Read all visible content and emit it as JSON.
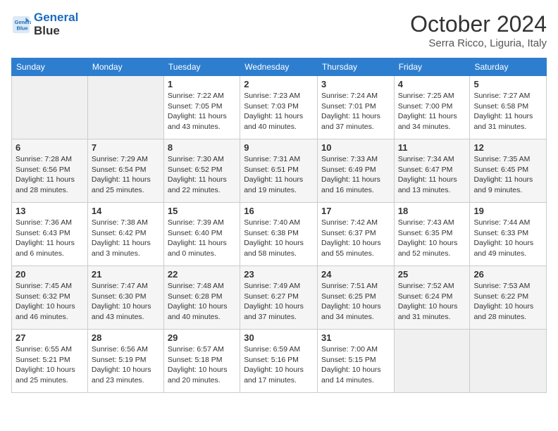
{
  "header": {
    "logo_line1": "General",
    "logo_line2": "Blue",
    "title": "October 2024",
    "subtitle": "Serra Ricco, Liguria, Italy"
  },
  "weekdays": [
    "Sunday",
    "Monday",
    "Tuesday",
    "Wednesday",
    "Thursday",
    "Friday",
    "Saturday"
  ],
  "weeks": [
    [
      {
        "day": "",
        "empty": true
      },
      {
        "day": "",
        "empty": true
      },
      {
        "day": "1",
        "sunrise": "7:22 AM",
        "sunset": "7:05 PM",
        "daylight": "11 hours and 43 minutes."
      },
      {
        "day": "2",
        "sunrise": "7:23 AM",
        "sunset": "7:03 PM",
        "daylight": "11 hours and 40 minutes."
      },
      {
        "day": "3",
        "sunrise": "7:24 AM",
        "sunset": "7:01 PM",
        "daylight": "11 hours and 37 minutes."
      },
      {
        "day": "4",
        "sunrise": "7:25 AM",
        "sunset": "7:00 PM",
        "daylight": "11 hours and 34 minutes."
      },
      {
        "day": "5",
        "sunrise": "7:27 AM",
        "sunset": "6:58 PM",
        "daylight": "11 hours and 31 minutes."
      }
    ],
    [
      {
        "day": "6",
        "sunrise": "7:28 AM",
        "sunset": "6:56 PM",
        "daylight": "11 hours and 28 minutes."
      },
      {
        "day": "7",
        "sunrise": "7:29 AM",
        "sunset": "6:54 PM",
        "daylight": "11 hours and 25 minutes."
      },
      {
        "day": "8",
        "sunrise": "7:30 AM",
        "sunset": "6:52 PM",
        "daylight": "11 hours and 22 minutes."
      },
      {
        "day": "9",
        "sunrise": "7:31 AM",
        "sunset": "6:51 PM",
        "daylight": "11 hours and 19 minutes."
      },
      {
        "day": "10",
        "sunrise": "7:33 AM",
        "sunset": "6:49 PM",
        "daylight": "11 hours and 16 minutes."
      },
      {
        "day": "11",
        "sunrise": "7:34 AM",
        "sunset": "6:47 PM",
        "daylight": "11 hours and 13 minutes."
      },
      {
        "day": "12",
        "sunrise": "7:35 AM",
        "sunset": "6:45 PM",
        "daylight": "11 hours and 9 minutes."
      }
    ],
    [
      {
        "day": "13",
        "sunrise": "7:36 AM",
        "sunset": "6:43 PM",
        "daylight": "11 hours and 6 minutes."
      },
      {
        "day": "14",
        "sunrise": "7:38 AM",
        "sunset": "6:42 PM",
        "daylight": "11 hours and 3 minutes."
      },
      {
        "day": "15",
        "sunrise": "7:39 AM",
        "sunset": "6:40 PM",
        "daylight": "11 hours and 0 minutes."
      },
      {
        "day": "16",
        "sunrise": "7:40 AM",
        "sunset": "6:38 PM",
        "daylight": "10 hours and 58 minutes."
      },
      {
        "day": "17",
        "sunrise": "7:42 AM",
        "sunset": "6:37 PM",
        "daylight": "10 hours and 55 minutes."
      },
      {
        "day": "18",
        "sunrise": "7:43 AM",
        "sunset": "6:35 PM",
        "daylight": "10 hours and 52 minutes."
      },
      {
        "day": "19",
        "sunrise": "7:44 AM",
        "sunset": "6:33 PM",
        "daylight": "10 hours and 49 minutes."
      }
    ],
    [
      {
        "day": "20",
        "sunrise": "7:45 AM",
        "sunset": "6:32 PM",
        "daylight": "10 hours and 46 minutes."
      },
      {
        "day": "21",
        "sunrise": "7:47 AM",
        "sunset": "6:30 PM",
        "daylight": "10 hours and 43 minutes."
      },
      {
        "day": "22",
        "sunrise": "7:48 AM",
        "sunset": "6:28 PM",
        "daylight": "10 hours and 40 minutes."
      },
      {
        "day": "23",
        "sunrise": "7:49 AM",
        "sunset": "6:27 PM",
        "daylight": "10 hours and 37 minutes."
      },
      {
        "day": "24",
        "sunrise": "7:51 AM",
        "sunset": "6:25 PM",
        "daylight": "10 hours and 34 minutes."
      },
      {
        "day": "25",
        "sunrise": "7:52 AM",
        "sunset": "6:24 PM",
        "daylight": "10 hours and 31 minutes."
      },
      {
        "day": "26",
        "sunrise": "7:53 AM",
        "sunset": "6:22 PM",
        "daylight": "10 hours and 28 minutes."
      }
    ],
    [
      {
        "day": "27",
        "sunrise": "6:55 AM",
        "sunset": "5:21 PM",
        "daylight": "10 hours and 25 minutes."
      },
      {
        "day": "28",
        "sunrise": "6:56 AM",
        "sunset": "5:19 PM",
        "daylight": "10 hours and 23 minutes."
      },
      {
        "day": "29",
        "sunrise": "6:57 AM",
        "sunset": "5:18 PM",
        "daylight": "10 hours and 20 minutes."
      },
      {
        "day": "30",
        "sunrise": "6:59 AM",
        "sunset": "5:16 PM",
        "daylight": "10 hours and 17 minutes."
      },
      {
        "day": "31",
        "sunrise": "7:00 AM",
        "sunset": "5:15 PM",
        "daylight": "10 hours and 14 minutes."
      },
      {
        "day": "",
        "empty": true
      },
      {
        "day": "",
        "empty": true
      }
    ]
  ]
}
